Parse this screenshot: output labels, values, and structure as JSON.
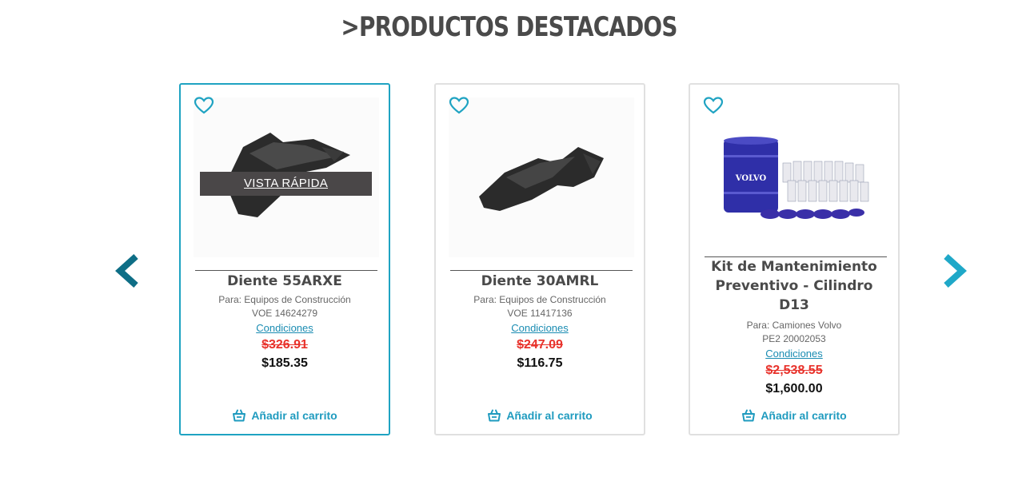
{
  "section_title": ">PRODUCTOS DESTACADOS",
  "colors": {
    "accent": "#1fa3c2",
    "arrow_prev": "#0e6e86",
    "arrow_next": "#1fa8c8",
    "old_price": "#e8332c"
  },
  "quick_view_label": "VISTA RÁPIDA",
  "products": [
    {
      "name": "Diente 55ARXE",
      "for": "Para: Equipos de Construcción",
      "sku": "VOE 14624279",
      "conditions": "Condiciones",
      "old_price": "$326.91",
      "price": "$185.35",
      "cart_label": "Añadir al carrito"
    },
    {
      "name": "Diente 30AMRL",
      "for": "Para: Equipos de Construcción",
      "sku": "VOE 11417136",
      "conditions": "Condiciones",
      "old_price": "$247.09",
      "price": "$116.75",
      "cart_label": "Añadir al carrito"
    },
    {
      "name": "Kit de Mantenimiento Preventivo - Cilindro D13",
      "for": "Para: Camiones Volvo",
      "sku": "PE2 20002053",
      "conditions": "Condiciones",
      "old_price": "$2,538.55",
      "price": "$1,600.00",
      "cart_label": "Añadir al carrito",
      "drum_label": "VOLVO"
    }
  ],
  "icons": {
    "prev": "chevron-left-icon",
    "next": "chevron-right-icon",
    "favorite": "heart-icon",
    "cart": "basket-icon"
  }
}
